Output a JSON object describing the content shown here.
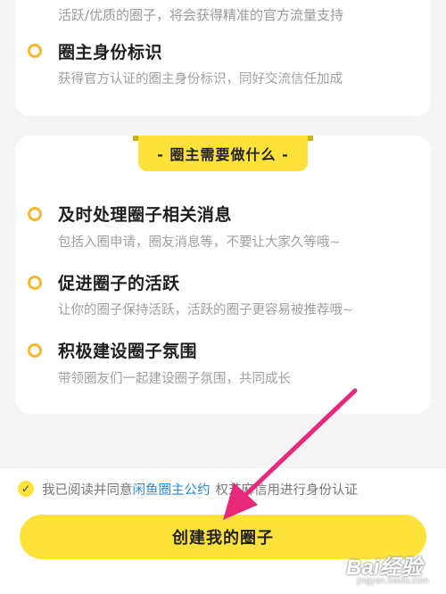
{
  "top_card": {
    "line1": "活跃/优质的圈子，将会获得精准的官方流量支持",
    "item": {
      "title": "圈主身份标识",
      "desc": "获得官方认证的圈主身份标识，同好交流信任加成"
    }
  },
  "duties": {
    "banner": "- 圈主需要做什么 -",
    "items": [
      {
        "title": "及时处理圈子相关消息",
        "desc": "包括入圈申请，圈友消息等，不要让大家久等哦~"
      },
      {
        "title": "促进圈子的活跃",
        "desc": "让你的圈子保持活跃，活跃的圈子更容易被推荐哦~"
      },
      {
        "title": "积极建设圈子氛围",
        "desc": "带领圈友们一起建设圈子氛围，共同成长"
      }
    ]
  },
  "agreement": {
    "check_mark": "✓",
    "prefix": "我已阅读并同意",
    "link": "闲鱼圈主公约",
    "suffix": "权芝麻信用进行身份认证"
  },
  "create_button": "创建我的圈子",
  "watermark": {
    "main": "Bai经验",
    "sub": "jingyan.baidu.com"
  },
  "colors": {
    "accent": "#fde23a",
    "dot": "#f5b82e",
    "link": "#2c89d4",
    "arrow": "#e8287a"
  }
}
